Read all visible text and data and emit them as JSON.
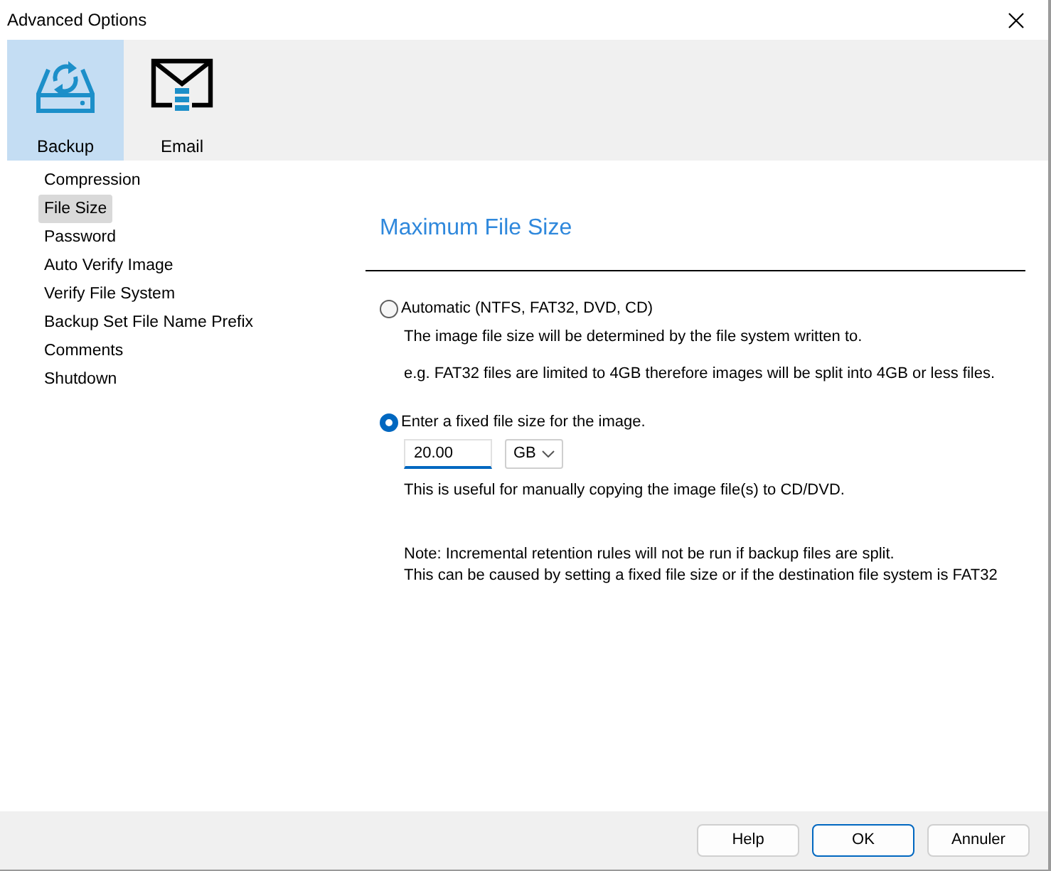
{
  "window": {
    "title": "Advanced Options"
  },
  "toolbar": [
    {
      "kind": "backup",
      "label": "Backup",
      "selected": true
    },
    {
      "kind": "email",
      "label": "Email",
      "selected": false
    }
  ],
  "sidebar": {
    "items": [
      {
        "label": "Compression",
        "selected": false
      },
      {
        "label": "File Size",
        "selected": true
      },
      {
        "label": "Password",
        "selected": false
      },
      {
        "label": "Auto Verify Image",
        "selected": false
      },
      {
        "label": "Verify File System",
        "selected": false
      },
      {
        "label": "Backup Set File Name Prefix",
        "selected": false
      },
      {
        "label": "Comments",
        "selected": false
      },
      {
        "label": "Shutdown",
        "selected": false
      }
    ]
  },
  "panel": {
    "title": "Maximum File Size",
    "options": [
      {
        "label": "Automatic (NTFS, FAT32, DVD, CD)",
        "selected": false,
        "descriptions": [
          "The image file size will be determined by the file system written to.",
          "e.g. FAT32 files are limited to 4GB therefore images will be split into 4GB or less files."
        ]
      },
      {
        "label": "Enter a fixed file size for the image.",
        "selected": true,
        "size_field": {
          "value": "20.00",
          "focused": true
        },
        "unit": "GB",
        "descriptions": [
          "This is useful for manually copying the image file(s) to CD/DVD."
        ]
      }
    ],
    "note": [
      "Note: Incremental retention rules will not be run if backup files are split.",
      "This can be caused by setting a fixed file size or if the destination file system is FAT32"
    ]
  },
  "buttons": [
    {
      "label": "Help",
      "default": false
    },
    {
      "label": "OK",
      "default": true
    },
    {
      "label": "Annuler",
      "default": false
    }
  ]
}
